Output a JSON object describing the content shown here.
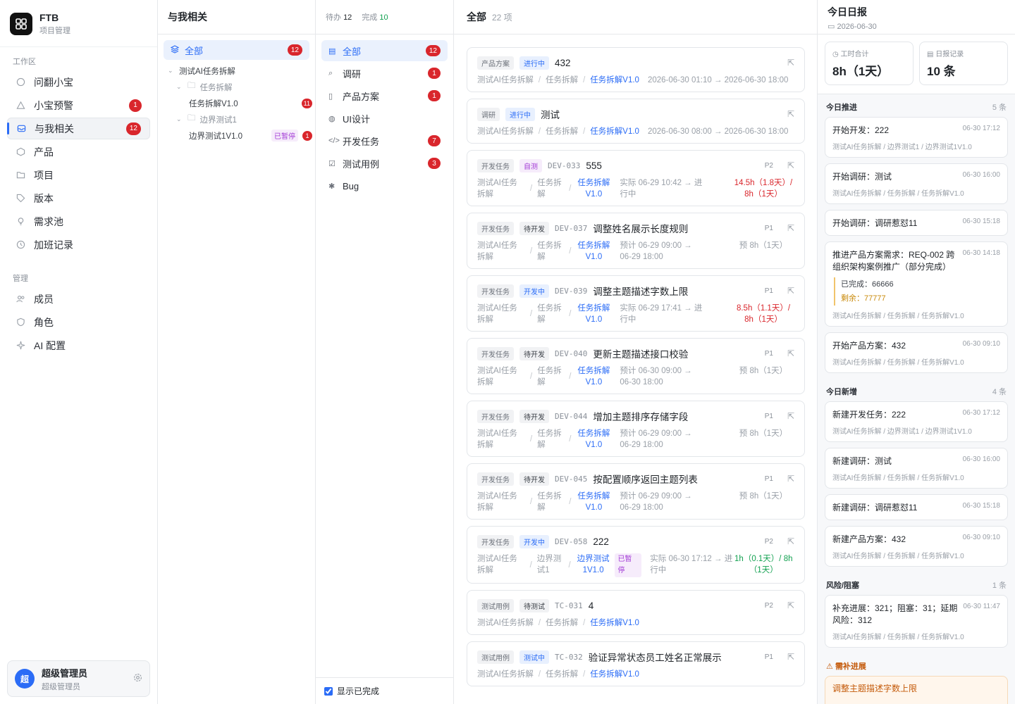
{
  "brand": {
    "title": "FTB",
    "subtitle": "项目管理"
  },
  "sidebar": {
    "workspace_label": "工作区",
    "workspace_items": [
      {
        "label": "问翻小宝",
        "icon": "chat-icon"
      },
      {
        "label": "小宝预警",
        "icon": "alert-icon",
        "badge": "1"
      },
      {
        "label": "与我相关",
        "icon": "inbox-icon",
        "badge": "12",
        "active": true
      },
      {
        "label": "产品",
        "icon": "box-icon"
      },
      {
        "label": "项目",
        "icon": "folder-icon"
      },
      {
        "label": "版本",
        "icon": "tag-icon"
      },
      {
        "label": "需求池",
        "icon": "bulb-icon"
      },
      {
        "label": "加班记录",
        "icon": "clock-icon"
      }
    ],
    "manage_label": "管理",
    "manage_items": [
      {
        "label": "成员",
        "icon": "users-icon"
      },
      {
        "label": "角色",
        "icon": "shield-icon"
      },
      {
        "label": "AI 配置",
        "icon": "sparkle-icon"
      }
    ],
    "user": {
      "avatar": "超",
      "name": "超级管理员",
      "role": "超级管理员"
    }
  },
  "tree": {
    "title": "与我相关",
    "all_label": "全部",
    "all_badge": "12",
    "nodes": [
      {
        "label": "测试AI任务拆解"
      },
      {
        "label": "任务拆解"
      },
      {
        "label": "任务拆解V1.0",
        "badge": "11"
      },
      {
        "label": "边界测试1"
      },
      {
        "label": "边界测试1V1.0",
        "tag": "已暂停",
        "badge": "1"
      }
    ]
  },
  "categories": {
    "todo_label": "待办",
    "todo_count": "12",
    "done_label": "完成",
    "done_count": "10",
    "items": [
      {
        "label": "全部",
        "badge": "12",
        "icon": "clipboard-icon",
        "active": true
      },
      {
        "label": "调研",
        "badge": "1",
        "icon": "search-icon"
      },
      {
        "label": "产品方案",
        "badge": "1",
        "icon": "doc-icon"
      },
      {
        "label": "UI设计",
        "badge": "",
        "icon": "palette-icon"
      },
      {
        "label": "开发任务",
        "badge": "7",
        "icon": "code-icon"
      },
      {
        "label": "测试用例",
        "badge": "3",
        "icon": "checklist-icon"
      },
      {
        "label": "Bug",
        "badge": "",
        "icon": "bug-icon"
      }
    ],
    "show_done_label": "显示已完成"
  },
  "main": {
    "title": "全部",
    "count": "22 项",
    "cards": [
      {
        "type": "产品方案",
        "status": "进行中",
        "status_color": "blue",
        "code": "",
        "title": "432",
        "priority": "",
        "path": [
          "测试AI任务拆解",
          "任务拆解",
          "任务拆解V1.0"
        ],
        "time": "2026-06-30 01:10 → 2026-06-30 18:00",
        "hours": "",
        "hours_color": ""
      },
      {
        "type": "调研",
        "status": "进行中",
        "status_color": "blue",
        "code": "",
        "title": "测试",
        "priority": "",
        "path": [
          "测试AI任务拆解",
          "任务拆解",
          "任务拆解V1.0"
        ],
        "time": "2026-06-30 08:00 → 2026-06-30 18:00",
        "hours": "",
        "hours_color": ""
      },
      {
        "type": "开发任务",
        "status": "自测",
        "status_color": "purple",
        "code": "DEV-033",
        "title": "555",
        "priority": "P2",
        "path": [
          "测试AI任务拆解",
          "任务拆解",
          "任务拆解V1.0"
        ],
        "time": "实际 06-29 10:42 → 进行中",
        "hours": "14.5h（1.8天）/ 8h（1天）",
        "hours_color": "red"
      },
      {
        "type": "开发任务",
        "status": "待开发",
        "status_color": "gray",
        "code": "DEV-037",
        "title": "调整姓名展示长度规则",
        "priority": "P1",
        "path": [
          "测试AI任务拆解",
          "任务拆解",
          "任务拆解V1.0"
        ],
        "time": "预计 06-29 09:00 → 06-29 18:00",
        "hours": "预 8h（1天）",
        "hours_color": ""
      },
      {
        "type": "开发任务",
        "status": "开发中",
        "status_color": "blue",
        "code": "DEV-039",
        "title": "调整主题描述字数上限",
        "priority": "P1",
        "path": [
          "测试AI任务拆解",
          "任务拆解",
          "任务拆解V1.0"
        ],
        "time": "实际 06-29 17:41 → 进行中",
        "hours": "8.5h（1.1天）/ 8h（1天）",
        "hours_color": "red"
      },
      {
        "type": "开发任务",
        "status": "待开发",
        "status_color": "gray",
        "code": "DEV-040",
        "title": "更新主题描述接口校验",
        "priority": "P1",
        "path": [
          "测试AI任务拆解",
          "任务拆解",
          "任务拆解V1.0"
        ],
        "time": "预计 06-30 09:00 → 06-30 18:00",
        "hours": "预 8h（1天）",
        "hours_color": ""
      },
      {
        "type": "开发任务",
        "status": "待开发",
        "status_color": "gray",
        "code": "DEV-044",
        "title": "增加主题排序存储字段",
        "priority": "P1",
        "path": [
          "测试AI任务拆解",
          "任务拆解",
          "任务拆解V1.0"
        ],
        "time": "预计 06-29 09:00 → 06-29 18:00",
        "hours": "预 8h（1天）",
        "hours_color": ""
      },
      {
        "type": "开发任务",
        "status": "待开发",
        "status_color": "gray",
        "code": "DEV-045",
        "title": "按配置顺序返回主题列表",
        "priority": "P1",
        "path": [
          "测试AI任务拆解",
          "任务拆解",
          "任务拆解V1.0"
        ],
        "time": "预计 06-29 09:00 → 06-29 18:00",
        "hours": "预 8h（1天）",
        "hours_color": ""
      },
      {
        "type": "开发任务",
        "status": "开发中",
        "status_color": "blue",
        "code": "DEV-058",
        "title": "222",
        "priority": "P2",
        "path": [
          "测试AI任务拆解",
          "边界测试1",
          "边界测试1V1.0"
        ],
        "tag": "已暂停",
        "time": "实际 06-30 17:12 → 进行中",
        "hours": "1h（0.1天）/ 8h（1天）",
        "hours_color": "green"
      },
      {
        "type": "测试用例",
        "status": "待测试",
        "status_color": "gray",
        "code": "TC-031",
        "title": "4",
        "priority": "P2",
        "path": [
          "测试AI任务拆解",
          "任务拆解",
          "任务拆解V1.0"
        ],
        "time": "",
        "hours": "",
        "hours_color": ""
      },
      {
        "type": "测试用例",
        "status": "测试中",
        "status_color": "blue",
        "code": "TC-032",
        "title": "验证异常状态员工姓名正常展示",
        "priority": "P1",
        "path": [
          "测试AI任务拆解",
          "任务拆解",
          "任务拆解V1.0"
        ],
        "time": "",
        "hours": "",
        "hours_color": ""
      }
    ]
  },
  "report": {
    "title": "今日日报",
    "date": "2026-06-30",
    "stat_hours_label": "工时合计",
    "stat_hours_value": "8h（1天）",
    "stat_records_label": "日报记录",
    "stat_records_value": "10 条",
    "progress_label": "今日推进",
    "progress_count": "5 条",
    "progress": [
      {
        "title": "开始开发：222",
        "time": "06-30 17:12",
        "path": "测试AI任务拆解 / 边界测试1 / 边界测试1V1.0"
      },
      {
        "title": "开始调研：测试",
        "time": "06-30 16:00",
        "path": "测试AI任务拆解 / 任务拆解 / 任务拆解V1.0"
      },
      {
        "title": "开始调研：调研惹怼11",
        "time": "06-30 15:18",
        "path": ""
      },
      {
        "title": "推进产品方案需求：REQ-002 跨组织架构案例推广（部分完成）",
        "time": "06-30 14:18",
        "path": "测试AI任务拆解 / 任务拆解 / 任务拆解V1.0",
        "done": "已完成：66666",
        "remain": "剩余：77777"
      },
      {
        "title": "开始产品方案：432",
        "time": "06-30 09:10",
        "path": "测试AI任务拆解 / 任务拆解 / 任务拆解V1.0"
      }
    ],
    "new_label": "今日新增",
    "new_count": "4 条",
    "new_items": [
      {
        "title": "新建开发任务：222",
        "time": "06-30 17:12",
        "path": "测试AI任务拆解 / 边界测试1 / 边界测试1V1.0"
      },
      {
        "title": "新建调研：测试",
        "time": "06-30 16:00",
        "path": "测试AI任务拆解 / 任务拆解 / 任务拆解V1.0"
      },
      {
        "title": "新建调研：调研惹怼11",
        "time": "06-30 15:18",
        "path": ""
      },
      {
        "title": "新建产品方案：432",
        "time": "06-30 09:10",
        "path": "测试AI任务拆解 / 任务拆解 / 任务拆解V1.0"
      }
    ],
    "risk_label": "风险/阻塞",
    "risk_count": "1 条",
    "risks": [
      {
        "title": "补充进展：321；阻塞：31；延期风险：312",
        "time": "06-30 11:47",
        "path": "测试AI任务拆解 / 任务拆解 / 任务拆解V1.0"
      }
    ],
    "need_label": "需补进展",
    "need_item": "调整主题描述字数上限"
  }
}
